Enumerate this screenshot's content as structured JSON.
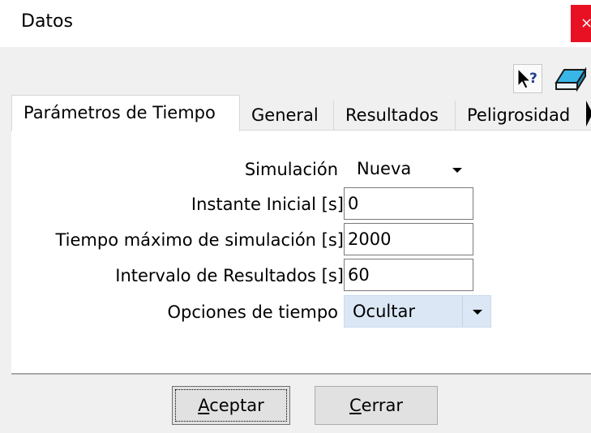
{
  "window": {
    "title": "Datos",
    "close_glyph": "×"
  },
  "toolbar": {
    "help_icon": "help-cursor-icon",
    "eraser_icon": "eraser-icon"
  },
  "tabs": [
    {
      "label": "Parámetros de Tiempo",
      "active": true
    },
    {
      "label": "General",
      "active": false
    },
    {
      "label": "Resultados",
      "active": false
    },
    {
      "label": "Peligrosidad",
      "active": false
    }
  ],
  "form": {
    "simulacion_label": "Simulación",
    "simulacion_value": "Nueva",
    "instante_inicial_label": "Instante Inicial [s]",
    "instante_inicial_value": "0",
    "tiempo_maximo_label": "Tiempo máximo de simulación [s]",
    "tiempo_maximo_value": "2000",
    "intervalo_label": "Intervalo de Resultados [s]",
    "intervalo_value": "60",
    "opciones_label": "Opciones de tiempo",
    "opciones_value": "Ocultar"
  },
  "buttons": {
    "aceptar_mnemonic": "A",
    "aceptar_rest": "ceptar",
    "cerrar_mnemonic": "C",
    "cerrar_rest": "errar"
  },
  "colors": {
    "close_bg": "#e81123",
    "combo_highlight": "#dbe7f4",
    "dialog_bg": "#f0f0f0"
  }
}
